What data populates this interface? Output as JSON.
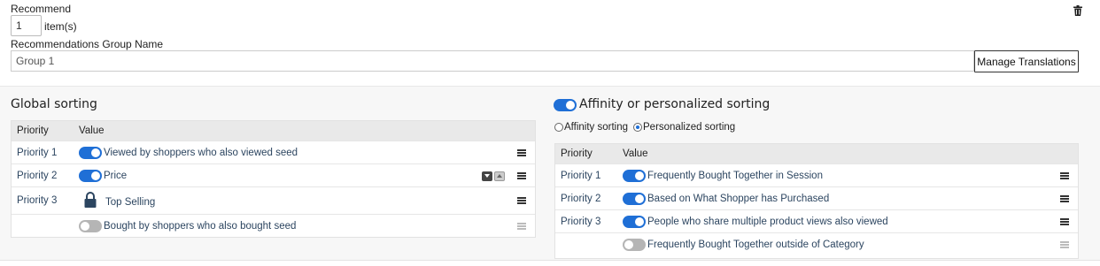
{
  "header": {
    "recommend_label": "Recommend",
    "quantity_value": "1",
    "items_suffix": "item(s)",
    "group_name_label": "Recommendations Group Name",
    "group_name_value": "Group 1",
    "manage_translations_label": "Manage Translations"
  },
  "global_sorting": {
    "title": "Global sorting",
    "columns": [
      "Priority",
      "Value"
    ],
    "rows": [
      {
        "priority": "Priority 1",
        "value": "Viewed by shoppers who also viewed seed",
        "enabled": true
      },
      {
        "priority": "Priority 2",
        "value": "Price",
        "enabled": true
      },
      {
        "priority": "Priority 3",
        "value": "Top Selling",
        "locked": true
      },
      {
        "priority": "",
        "value": "Bought by shoppers who also bought seed",
        "enabled": false
      }
    ]
  },
  "affinity_sorting": {
    "title": "Affinity or personalized sorting",
    "enabled": true,
    "radio_options": [
      "Affinity sorting",
      "Personalized sorting"
    ],
    "selected_option": "Personalized sorting",
    "columns": [
      "Priority",
      "Value"
    ],
    "rows": [
      {
        "priority": "Priority 1",
        "value": "Frequently Bought Together in Session",
        "enabled": true
      },
      {
        "priority": "Priority 2",
        "value": "Based on What Shopper has Purchased",
        "enabled": true
      },
      {
        "priority": "Priority 3",
        "value": "People who share multiple product views also viewed",
        "enabled": true
      },
      {
        "priority": "",
        "value": "Frequently Bought Together outside of Category",
        "enabled": false
      }
    ]
  },
  "colors": {
    "toggle_on": "#1f6fd6",
    "toggle_off": "#b5b5b5",
    "priority_text": "#2c4560",
    "table_header_bg": "#e9e9e9"
  },
  "icons": {
    "delete": "trash-icon",
    "drag": "drag-handle-icon",
    "lock": "lock-icon"
  }
}
